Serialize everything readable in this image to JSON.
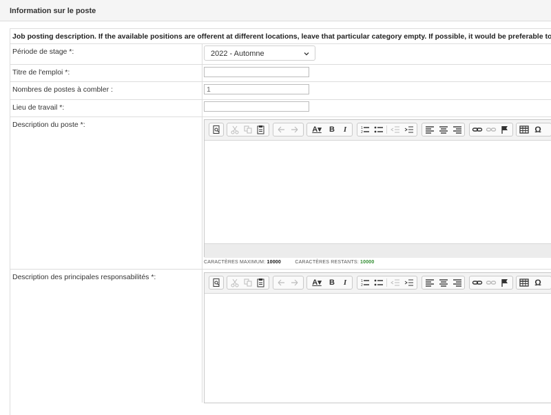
{
  "panel": {
    "title": "Information sur le poste"
  },
  "intro": "Job posting description. If the available positions are offerent at different locations, leave that particular category empty. If possible, it would be preferable to open a job posting per available position",
  "form": {
    "period_label": "Période de stage *:",
    "period_value": "2022 - Automne",
    "title_label": "Titre de l'emploi *:",
    "title_value": "",
    "positions_label": "Nombres de postes à combler :",
    "positions_value": "1",
    "location_label": "Lieu de travail *:",
    "location_value": "",
    "description_label": "Description du poste *:",
    "responsibilities_label": "Description des principales responsabilités *:"
  },
  "toolbar": {
    "format_letter": "A",
    "bold": "B",
    "italic": "I",
    "special_char": "Ω"
  },
  "counter": {
    "max_label": "CARACTÈRES MAXIMUM:",
    "max_value": "10000",
    "remaining_label": "CARACTÈRES RESTANTS:",
    "remaining_value": "10000"
  },
  "colors": {
    "remaining": "#2e8b2e",
    "border": "#dcdcdc",
    "toolbar_bg": "#f3f3f3"
  },
  "icons": [
    "preview-icon",
    "cut-icon",
    "copy-icon",
    "paste-icon",
    "undo-icon",
    "redo-icon",
    "text-color-icon",
    "bold-icon",
    "italic-icon",
    "numbered-list-icon",
    "bulleted-list-icon",
    "outdent-icon",
    "indent-icon",
    "align-left-icon",
    "align-center-icon",
    "align-right-icon",
    "link-icon",
    "unlink-icon",
    "anchor-icon",
    "table-icon",
    "special-char-icon"
  ]
}
